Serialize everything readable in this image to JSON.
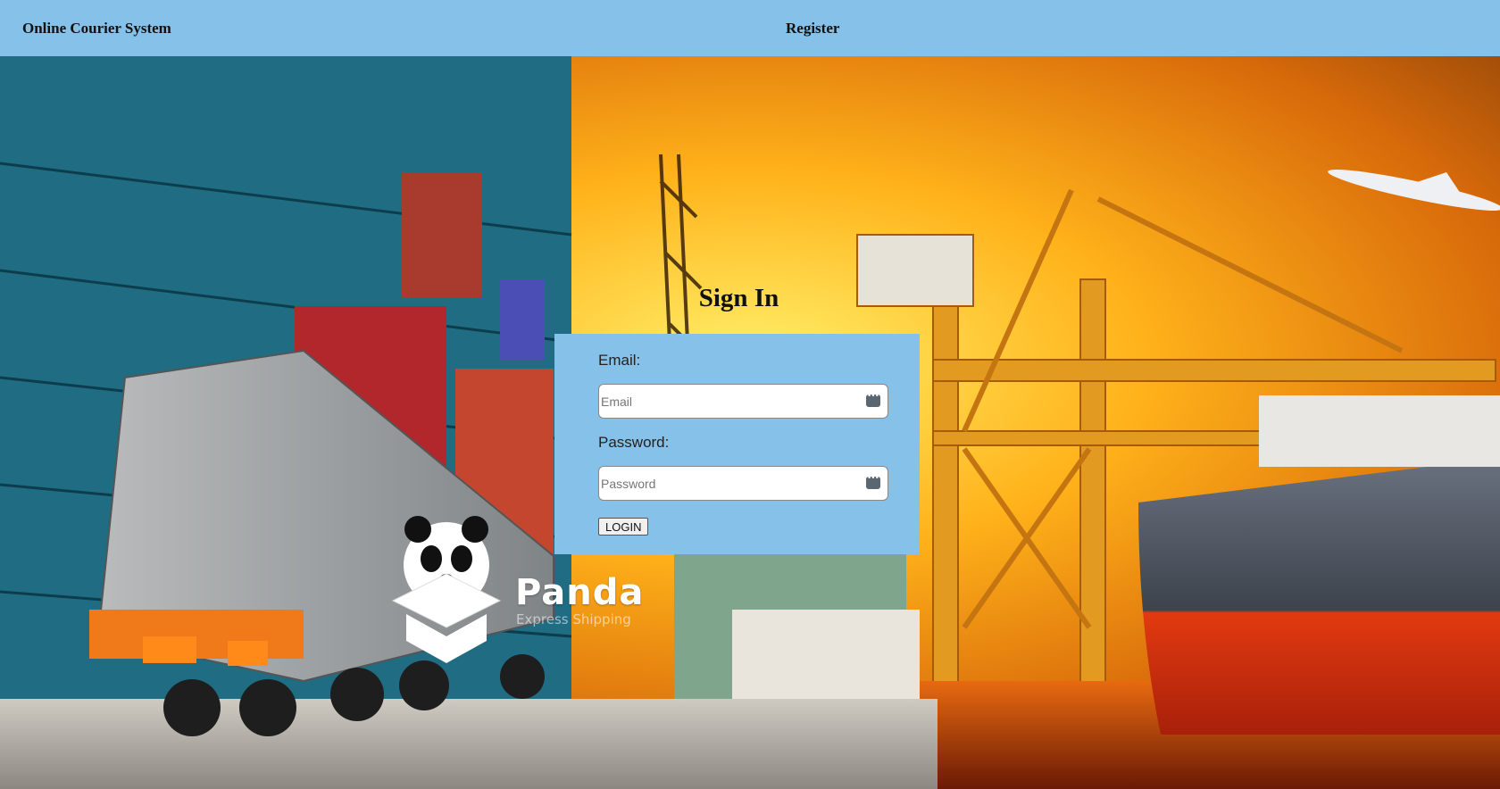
{
  "navbar": {
    "brand": "Online Courier System",
    "register_label": "Register"
  },
  "signin": {
    "title": "Sign In",
    "email_label": "Email:",
    "email_placeholder": "Email",
    "email_value": "",
    "password_label": "Password:",
    "password_placeholder": "Password",
    "password_value": "",
    "login_label": "LOGIN"
  },
  "background": {
    "logo_word": "Panda",
    "logo_tagline": "Express Shipping"
  },
  "colors": {
    "navbar_bg": "#85c1e9",
    "card_bg": "#85c1e9",
    "sky_top": "#c98a00",
    "sky_glow": "#ffe15a"
  }
}
